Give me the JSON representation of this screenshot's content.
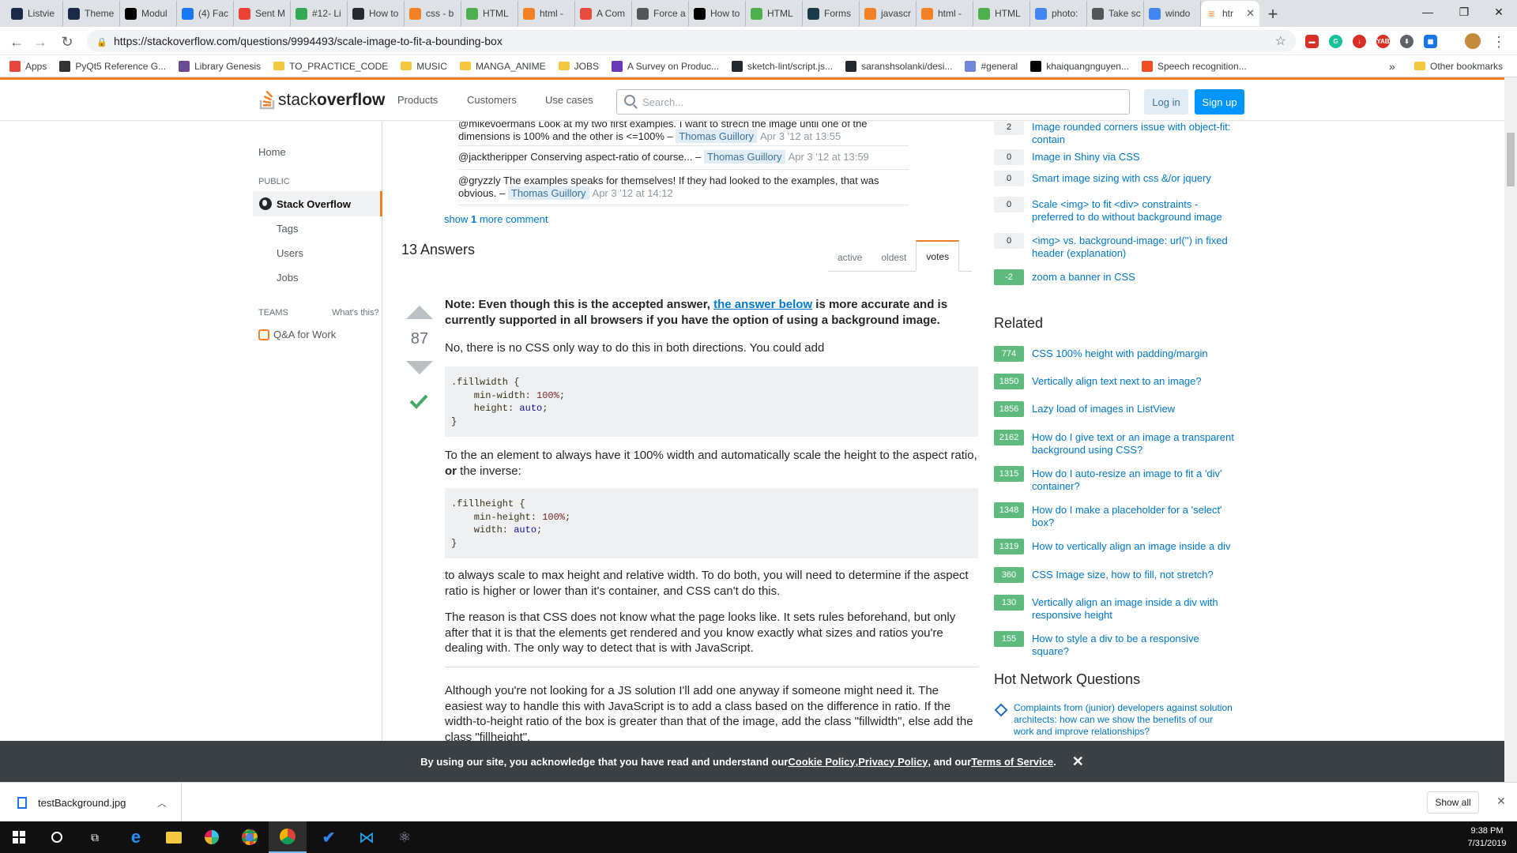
{
  "browser": {
    "tabs": [
      {
        "label": "Listvie",
        "color": "#1b2a4a"
      },
      {
        "label": "Theme",
        "color": "#1b2a4a"
      },
      {
        "label": "Modul",
        "color": "#000000"
      },
      {
        "label": "(4) Fac",
        "color": "#1877f2"
      },
      {
        "label": "Sent M",
        "color": "#ea4335"
      },
      {
        "label": "#12- Li",
        "color": "#34a853"
      },
      {
        "label": "How to",
        "color": "#24292e"
      },
      {
        "label": "css - b",
        "color": "#f48024"
      },
      {
        "label": "HTML",
        "color": "#4caf50"
      },
      {
        "label": "html -",
        "color": "#f48024"
      },
      {
        "label": "A Com",
        "color": "#e74c3c"
      },
      {
        "label": "Force a",
        "color": "#555555"
      },
      {
        "label": "How to",
        "color": "#000000"
      },
      {
        "label": "HTML",
        "color": "#4caf50"
      },
      {
        "label": "Forms",
        "color": "#1b3a4a"
      },
      {
        "label": "javascr",
        "color": "#f48024"
      },
      {
        "label": "html -",
        "color": "#f48024"
      },
      {
        "label": "HTML",
        "color": "#4caf50"
      },
      {
        "label": "photo:",
        "color": "#4285f4"
      },
      {
        "label": "Take sc",
        "color": "#555555"
      },
      {
        "label": "windo",
        "color": "#4285f4"
      }
    ],
    "active_tab": {
      "label": "htr",
      "close": "✕"
    },
    "new_tab": "+",
    "url": "https://stackoverflow.com/questions/9994493/scale-image-to-fit-a-bounding-box",
    "bookmarks": [
      {
        "label": "Apps",
        "color": "#e8453c"
      },
      {
        "label": "PyQt5 Reference G...",
        "color": "#333333"
      },
      {
        "label": "Library Genesis",
        "color": "#6a4c93"
      },
      {
        "label": "TO_PRACTICE_CODE",
        "color": "folder"
      },
      {
        "label": "MUSIC",
        "color": "folder"
      },
      {
        "label": "MANGA_ANIME",
        "color": "folder"
      },
      {
        "label": "JOBS",
        "color": "folder"
      },
      {
        "label": "A Survey on Produc...",
        "color": "#673ab7"
      },
      {
        "label": "sketch-lint/script.js...",
        "color": "#24292e"
      },
      {
        "label": "saranshsolanki/desi...",
        "color": "#24292e"
      },
      {
        "label": "#general",
        "color": "#7289da"
      },
      {
        "label": "khaiquangnguyen...",
        "color": "#000000"
      },
      {
        "label": "Speech recognition...",
        "color": "#f25022"
      }
    ],
    "bookmarks_overflow": "»",
    "other_bookmarks": "Other bookmarks"
  },
  "so_header": {
    "logo_a": "stack",
    "logo_b": "overflow",
    "nav": [
      "Products",
      "Customers",
      "Use cases"
    ],
    "search_placeholder": "Search...",
    "login": "Log in",
    "signup": "Sign up"
  },
  "left_nav": {
    "home": "Home",
    "public": "PUBLIC",
    "stackoverflow": "Stack Overflow",
    "tags": "Tags",
    "users": "Users",
    "jobs": "Jobs",
    "teams": "TEAMS",
    "whats_this": "What's this?",
    "qa_work": "Q&A for Work"
  },
  "comments": [
    {
      "text": "@mikevoermans Look at my two first examples. I want to strech the image until one of the dimensions is 100% and the other is <=100% –",
      "user": "Thomas Guillory",
      "date": "Apr 3 '12 at 13:55"
    },
    {
      "text": "@jacktheripper Conserving aspect-ratio of course... –",
      "user": "Thomas Guillory",
      "date": "Apr 3 '12 at 13:59"
    },
    {
      "text": "@gryzzly The examples speaks for themselves! If they had looked to the examples, that was obvious. –",
      "user": "Thomas Guillory",
      "date": "Apr 3 '12 at 14:12"
    }
  ],
  "show_more": {
    "prefix": "show ",
    "count": "1",
    "suffix": " more comment"
  },
  "answers_header": "13 Answers",
  "sort_tabs": [
    "active",
    "oldest",
    "votes"
  ],
  "answer": {
    "votes": "87",
    "note_a": "Note: Even though this is the accepted answer, ",
    "note_link": "the answer below",
    "note_b": " is more accurate and is currently supported in all browsers if you have the option of using a background image.",
    "p1": "No, there is no CSS only way to do this in both directions. You could add",
    "code1": {
      "selector": ".fillwidth {",
      "l1_prop": "    min-width: ",
      "l1_val": "100%",
      "l2_prop": "    height: ",
      "l2_val": "auto",
      "close": "}"
    },
    "p2_a": "To the an element to always have it 100% width and automatically scale the height to the aspect ratio, ",
    "p2_or": "or",
    "p2_b": " the inverse:",
    "code2": {
      "selector": ".fillheight {",
      "l1_prop": "    min-height: ",
      "l1_val": "100%",
      "l2_prop": "    width: ",
      "l2_val": "auto",
      "close": "}"
    },
    "p3": "to always scale to max height and relative width. To do both, you will need to determine if the aspect ratio is higher or lower than it's container, and CSS can't do this.",
    "p4": "The reason is that CSS does not know what the page looks like. It sets rules beforehand, but only after that it is that the elements get rendered and you know exactly what sizes and ratios you're dealing with. The only way to detect that is with JavaScript.",
    "p5": "Although you're not looking for a JS solution I'll add one anyway if someone might need it. The easiest way to handle this with JavaScript is to add a class based on the difference in ratio. If the width-to-height ratio of the box is greater than that of the image, add the class \"fillwidth\", else add the class \"fillheight\"."
  },
  "sidebar": {
    "linked": [
      {
        "count": "2",
        "title": "Image rounded corners issue with object-fit: contain"
      },
      {
        "count": "0",
        "title": "Image in Shiny via CSS"
      },
      {
        "count": "0",
        "title": "Smart image sizing with css &/or jquery"
      },
      {
        "count": "0",
        "title": "Scale <img> to fit <div> constraints - preferred to do without background image"
      },
      {
        "count": "0",
        "title": "<img> vs. background-image: url('') in fixed header (explanation)"
      },
      {
        "count": "-2",
        "title": "zoom a banner in CSS"
      }
    ],
    "related_head": "Related",
    "related": [
      {
        "count": "774",
        "title": "CSS 100% height with padding/margin"
      },
      {
        "count": "1850",
        "title": "Vertically align text next to an image?"
      },
      {
        "count": "1856",
        "title": "Lazy load of images in ListView"
      },
      {
        "count": "2162",
        "title": "How do I give text or an image a transparent background using CSS?"
      },
      {
        "count": "1315",
        "title": "How do I auto-resize an image to fit a 'div' container?"
      },
      {
        "count": "1348",
        "title": "How do I make a placeholder for a 'select' box?"
      },
      {
        "count": "1319",
        "title": "How to vertically align an image inside a div"
      },
      {
        "count": "360",
        "title": "CSS Image size, how to fill, not stretch?"
      },
      {
        "count": "130",
        "title": "Vertically align an image inside a div with responsive height"
      },
      {
        "count": "155",
        "title": "How to style a div to be a responsive square?"
      }
    ],
    "hot_head": "Hot Network Questions",
    "hot_q": "Complaints from (junior) developers against solution architects: how can we show the benefits of our work and improve relationships?"
  },
  "cookie": {
    "a": "By using our site, you acknowledge that you have read and understand our ",
    "cookie_policy": "Cookie Policy",
    "comma": ", ",
    "privacy": "Privacy Policy",
    "and": ", and our ",
    "terms": "Terms of Service",
    "dot": ".",
    "close": "✕"
  },
  "download_bar": {
    "file": "testBackground.jpg",
    "show_all": "Show all",
    "close": "✕"
  },
  "taskbar": {
    "time": "9:38 PM",
    "date": "7/31/2019"
  }
}
